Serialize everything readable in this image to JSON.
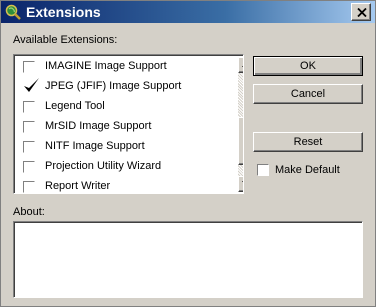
{
  "window": {
    "title": "Extensions",
    "titlebar_colors": [
      "#0a246a",
      "#a6caf0"
    ],
    "icon": "magnifier-globe-icon"
  },
  "list": {
    "label": "Available Extensions:",
    "items": [
      {
        "label": "IMAGINE Image Support",
        "checked": false
      },
      {
        "label": "JPEG (JFIF) Image Support",
        "checked": true
      },
      {
        "label": "Legend Tool",
        "checked": false
      },
      {
        "label": "MrSID Image Support",
        "checked": false
      },
      {
        "label": "NITF Image Support",
        "checked": false
      },
      {
        "label": "Projection Utility Wizard",
        "checked": false
      },
      {
        "label": "Report Writer",
        "checked": false
      }
    ]
  },
  "buttons": {
    "ok": "OK",
    "cancel": "Cancel",
    "reset": "Reset"
  },
  "make_default": {
    "label": "Make Default",
    "checked": false
  },
  "about": {
    "label": "About:",
    "text": ""
  }
}
